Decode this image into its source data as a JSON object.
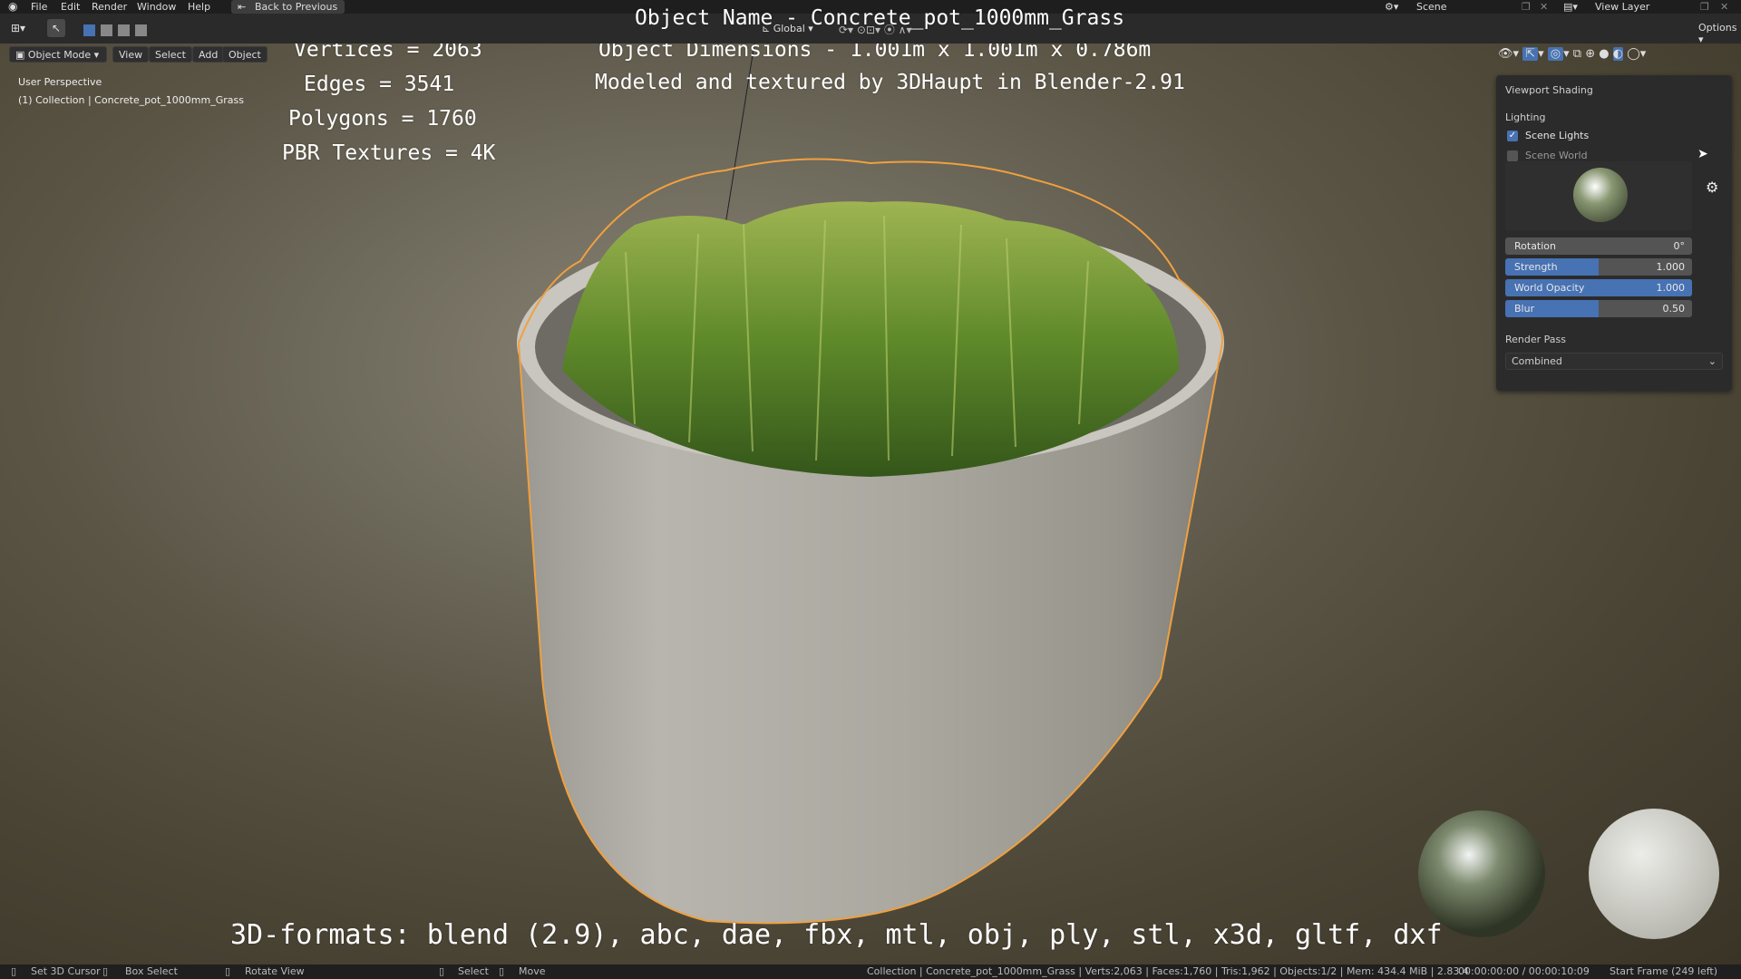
{
  "menu": {
    "items": [
      "File",
      "Edit",
      "Render",
      "Window",
      "Help"
    ],
    "back_button": "Back to Previous",
    "scene": "Scene",
    "view_layer": "View Layer",
    "options": "Options"
  },
  "header": {
    "mode": "Object Mode",
    "view": "View",
    "select": "Select",
    "add": "Add",
    "object": "Object",
    "transform_orientation": "Global"
  },
  "viewport": {
    "perspective": "User Perspective",
    "collection": "(1) Collection | Concrete_pot_1000mm_Grass",
    "stats": {
      "vertices": "Vertices = 2063",
      "edges": "Edges = 3541",
      "polygons": "Polygons = 1760",
      "textures": "PBR Textures = 4K"
    },
    "info": {
      "object_name": "Object Name - Concrete_pot_1000mm_Grass",
      "dimensions": "Object Dimensions -  1.001m x 1.001m x 0.786m",
      "credit": "Modeled and textured by 3DHaupt in Blender-2.91"
    },
    "formats": "3D-formats: blend (2.9), abc, dae, fbx, mtl, obj, ply, stl, x3d, gltf, dxf"
  },
  "shading_panel": {
    "title": "Viewport Shading",
    "lighting_label": "Lighting",
    "scene_lights": "Scene Lights",
    "scene_lights_checked": true,
    "scene_world": "Scene World",
    "scene_world_checked": false,
    "sliders": [
      {
        "label": "Rotation",
        "value": "0°",
        "fraction": 0
      },
      {
        "label": "Strength",
        "value": "1.000",
        "fraction": 0.5
      },
      {
        "label": "World Opacity",
        "value": "1.000",
        "fraction": 1.0
      },
      {
        "label": "Blur",
        "value": "0.50",
        "fraction": 0.5
      }
    ],
    "render_pass_label": "Render Pass",
    "render_pass_value": "Combined"
  },
  "statusbar": {
    "set_cursor": "Set 3D Cursor",
    "box_select": "Box Select",
    "rotate_view": "Rotate View",
    "select": "Select",
    "move": "Move",
    "stats": "Collection | Concrete_pot_1000mm_Grass | Verts:2,063 | Faces:1,760 | Tris:1,962 | Objects:1/2 | Mem: 434.4 MiB | 2.83.4",
    "time": "00:00:00:00 / 00:00:10:09",
    "frame": "Start Frame (249 left)"
  },
  "colors": {
    "accent": "#4772b3",
    "selection_outline": "#f0a040"
  }
}
